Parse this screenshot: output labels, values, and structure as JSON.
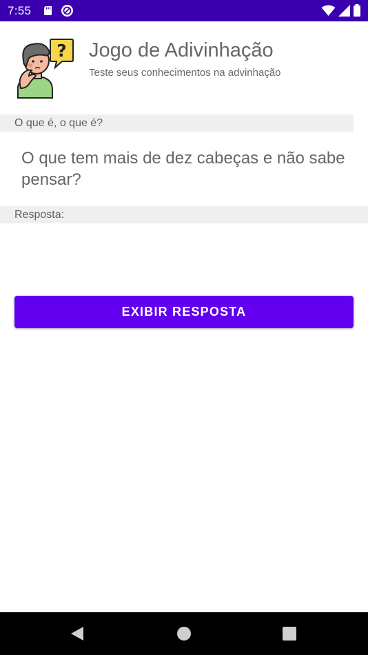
{
  "status_bar": {
    "time": "7:55",
    "left_icons": [
      "sd-card-icon",
      "sync-icon"
    ],
    "right_icons": [
      "wifi-icon",
      "signal-icon",
      "battery-icon"
    ],
    "background": "#3a00b0"
  },
  "header": {
    "title": "Jogo de Adivinhação",
    "subtitle": "Teste seus conhecimentos na advinhação",
    "logo_icon": "thinking-person-question-icon"
  },
  "question_section": {
    "label": "O que é, o que é?",
    "riddle": "O que tem mais de dez cabeças e não sabe pensar?"
  },
  "answer_section": {
    "label": "Resposta:",
    "answer": ""
  },
  "actions": {
    "show_answer_label": "EXIBIR RESPOSTA"
  },
  "nav_bar": {
    "icons": [
      "back-icon",
      "home-icon",
      "recents-icon"
    ]
  },
  "colors": {
    "accent": "#6200ee",
    "strip": "#efefef",
    "text_gray": "#666666"
  }
}
